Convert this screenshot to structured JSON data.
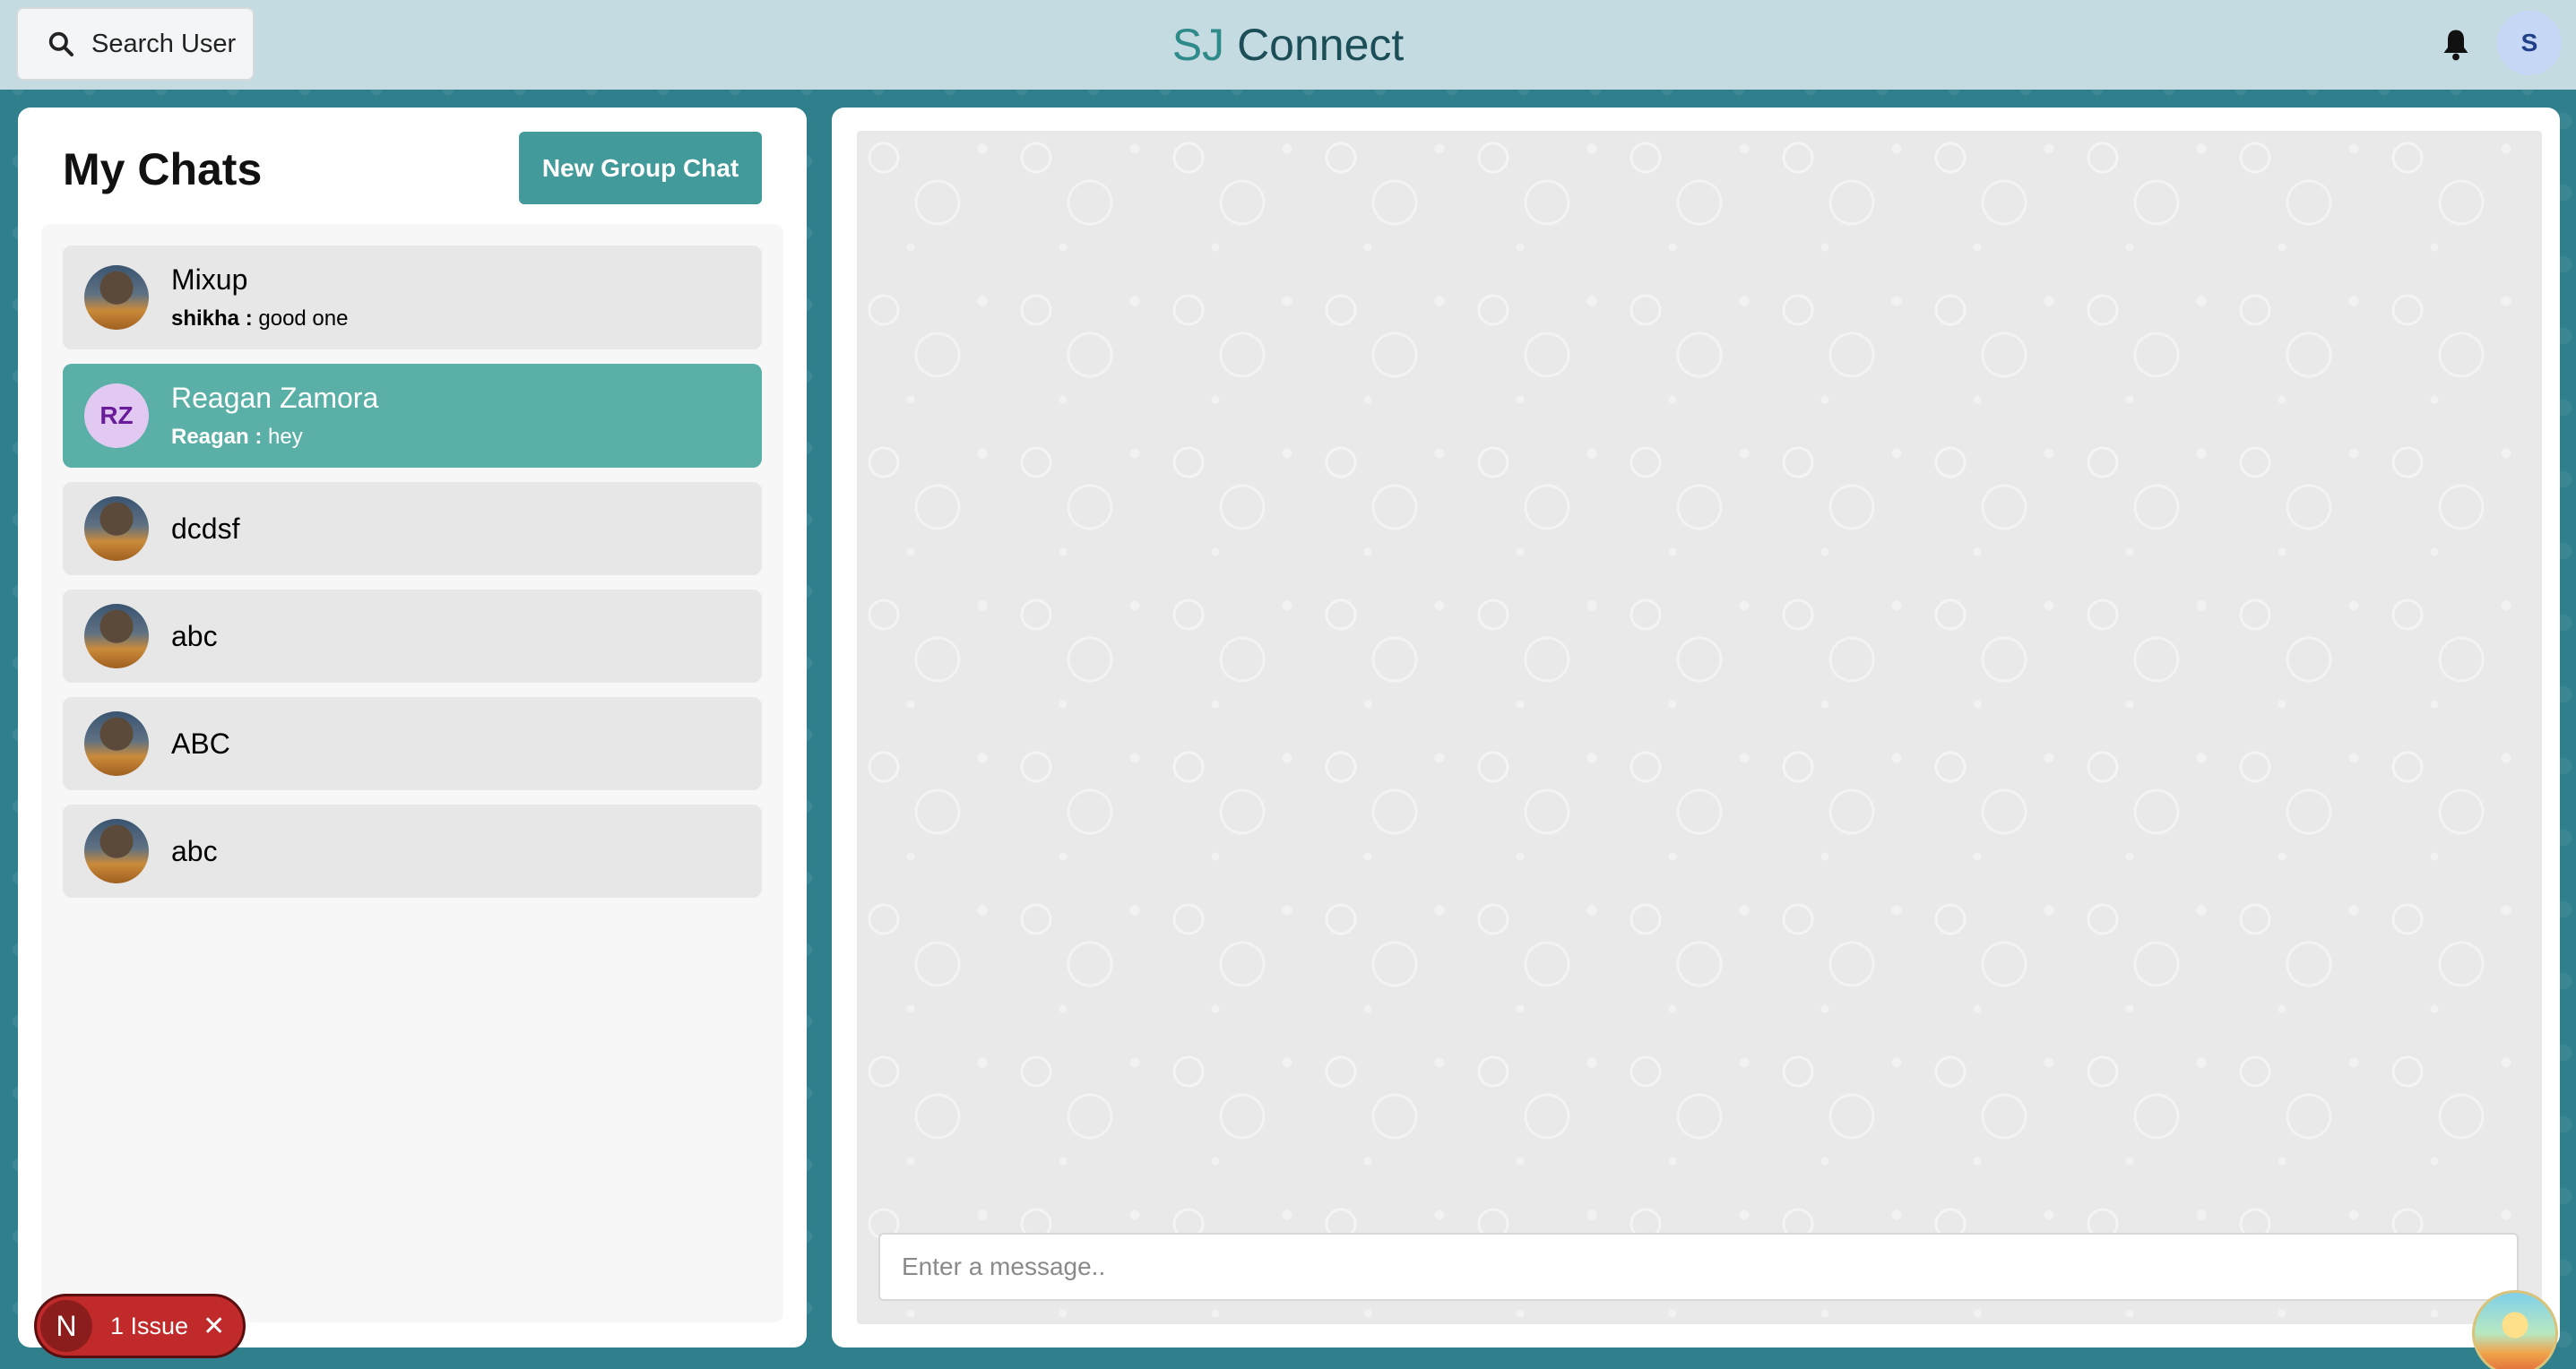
{
  "header": {
    "search_label": "Search User",
    "brand_prefix": "SJ",
    "brand_name": "Connect",
    "user_initial": "S"
  },
  "sidebar": {
    "title": "My Chats",
    "new_group_label": "New Group Chat",
    "chats": [
      {
        "name": "Mixup",
        "sender": "shikha :",
        "message": "good one",
        "avatar": "photo",
        "active": false
      },
      {
        "name": "Reagan Zamora",
        "sender": "Reagan :",
        "message": "hey",
        "avatar": "RZ",
        "active": true
      },
      {
        "name": "dcdsf",
        "avatar": "photo",
        "active": false
      },
      {
        "name": "abc",
        "avatar": "photo",
        "active": false
      },
      {
        "name": "ABC",
        "avatar": "photo",
        "active": false
      },
      {
        "name": "abc",
        "avatar": "photo",
        "active": false
      }
    ]
  },
  "chat": {
    "input_placeholder": "Enter a message.."
  },
  "badge": {
    "logo": "N",
    "label": "1 Issue",
    "close": "✕"
  },
  "colors": {
    "accent": "#439a9a",
    "active_chat": "#5ab0a7",
    "header_bg": "#c4dbe1",
    "page_bg": "#2f7f8d",
    "issue_badge": "#c02a2a"
  }
}
